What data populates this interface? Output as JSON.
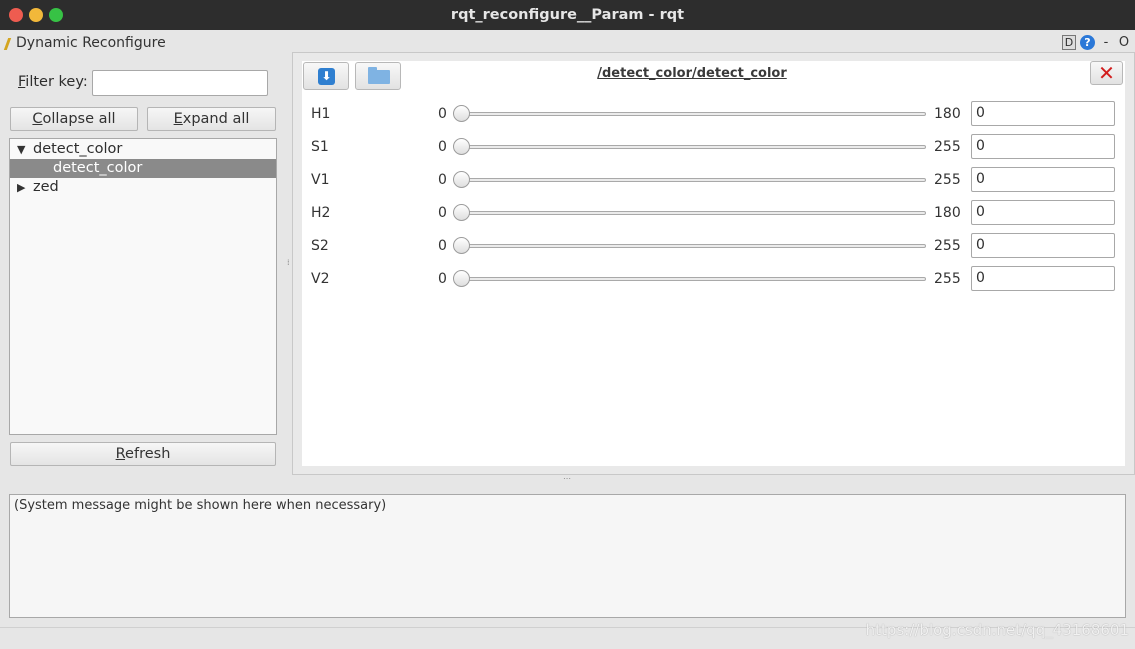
{
  "window": {
    "title": "rqt_reconfigure__Param - rqt"
  },
  "plugin": {
    "title": "Dynamic Reconfigure",
    "d_label": "D",
    "help_label": "?",
    "min_label": "-",
    "close_label": "O"
  },
  "filter": {
    "label_pre": "F",
    "label_post": "ilter key:",
    "value": ""
  },
  "buttons": {
    "collapse_pre": "C",
    "collapse_post": "ollapse all",
    "expand_pre": "E",
    "expand_post": "xpand all",
    "refresh_pre": "R",
    "refresh_post": "efresh"
  },
  "tree": {
    "items": [
      {
        "label": "detect_color",
        "expanded": true
      },
      {
        "label": "detect_color",
        "selected": true
      },
      {
        "label": "zed",
        "expanded": false
      }
    ]
  },
  "node_panel": {
    "title": "/detect_color/detect_color",
    "close_label": "✕",
    "save_icon": "save-icon",
    "load_icon": "folder-icon"
  },
  "params": [
    {
      "name": "H1",
      "min": "0",
      "max": "180",
      "value": "0"
    },
    {
      "name": "S1",
      "min": "0",
      "max": "255",
      "value": "0"
    },
    {
      "name": "V1",
      "min": "0",
      "max": "255",
      "value": "0"
    },
    {
      "name": "H2",
      "min": "0",
      "max": "180",
      "value": "0"
    },
    {
      "name": "S2",
      "min": "0",
      "max": "255",
      "value": "0"
    },
    {
      "name": "V2",
      "min": "0",
      "max": "255",
      "value": "0"
    }
  ],
  "message": {
    "text": "(System message might be shown here when necessary)"
  },
  "watermark": "https://blog.csdn.net/qq_43168601"
}
